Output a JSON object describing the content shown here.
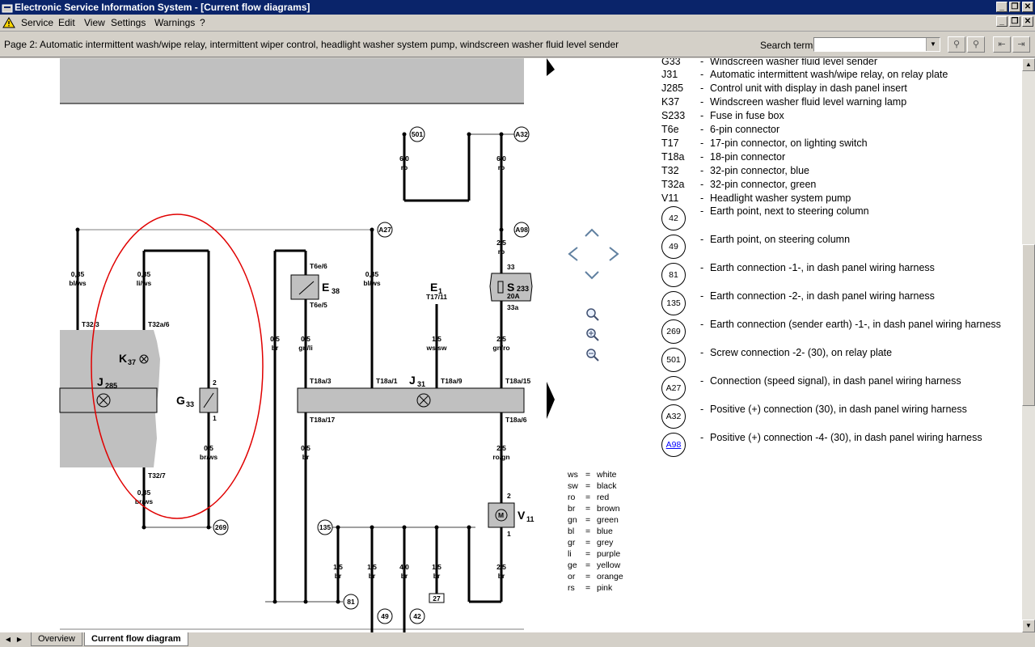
{
  "window": {
    "title": "Electronic Service Information System - [Current flow diagrams]"
  },
  "menu": [
    "Service",
    "Edit",
    "View",
    "Settings",
    "Warnings",
    "?"
  ],
  "toolbar": {
    "page_label": "Page 2: Automatic intermittent wash/wipe relay, intermittent wiper control, headlight washer system pump, windscreen washer fluid level sender",
    "search_label": "Search term:",
    "search_value": ""
  },
  "legend": {
    "components": [
      {
        "code": "G33",
        "desc": "Windscreen washer fluid level sender"
      },
      {
        "code": "J31",
        "desc": "Automatic intermittent wash/wipe relay, on relay plate"
      },
      {
        "code": "J285",
        "desc": "Control unit with display in dash panel insert"
      },
      {
        "code": "K37",
        "desc": "Windscreen washer fluid level warning lamp"
      },
      {
        "code": "S233",
        "desc": "Fuse in fuse box"
      },
      {
        "code": "T6e",
        "desc": "6-pin connector"
      },
      {
        "code": "T17",
        "desc": "17-pin connector, on lighting switch"
      },
      {
        "code": "T18a",
        "desc": "18-pin connector"
      },
      {
        "code": "T32",
        "desc": "32-pin connector, blue"
      },
      {
        "code": "T32a",
        "desc": "32-pin connector, green"
      },
      {
        "code": "V11",
        "desc": "Headlight washer system pump"
      }
    ],
    "circles": [
      {
        "code": "42",
        "desc": "Earth point, next to steering column"
      },
      {
        "code": "49",
        "desc": "Earth point, on steering column"
      },
      {
        "code": "81",
        "desc": "Earth connection -1-, in dash panel wiring harness"
      },
      {
        "code": "135",
        "desc": "Earth connection -2-, in dash panel wiring harness"
      },
      {
        "code": "269",
        "desc": "Earth connection (sender earth) -1-, in dash panel wiring harness"
      },
      {
        "code": "501",
        "desc": "Screw connection -2- (30), on relay plate"
      },
      {
        "code": "A27",
        "desc": "Connection (speed signal), in dash panel wiring harness"
      },
      {
        "code": "A32",
        "desc": "Positive (+) connection (30), in dash panel wiring harness"
      },
      {
        "code": "A98",
        "desc": "Positive (+) connection -4- (30), in dash panel wiring harness"
      }
    ]
  },
  "color_key": [
    {
      "abbr": "ws",
      "name": "white"
    },
    {
      "abbr": "sw",
      "name": "black"
    },
    {
      "abbr": "ro",
      "name": "red"
    },
    {
      "abbr": "br",
      "name": "brown"
    },
    {
      "abbr": "gn",
      "name": "green"
    },
    {
      "abbr": "bl",
      "name": "blue"
    },
    {
      "abbr": "gr",
      "name": "grey"
    },
    {
      "abbr": "li",
      "name": "purple"
    },
    {
      "abbr": "ge",
      "name": "yellow"
    },
    {
      "abbr": "or",
      "name": "orange"
    },
    {
      "abbr": "rs",
      "name": "pink"
    }
  ],
  "diagram": {
    "components": {
      "J285": "J",
      "J285_sub": "285",
      "K37": "K",
      "K37_sub": "37",
      "G33": "G",
      "G33_sub": "33",
      "E38": "E",
      "E38_sub": "38",
      "J31": "J",
      "J31_sub": "31",
      "E1": "E",
      "E1_sub": "1",
      "S233": "S",
      "S233_sub": "233",
      "S233_rating": "20A",
      "V11": "V",
      "V11_sub": "11",
      "E1_pin": "T17/11"
    },
    "wires": [
      {
        "size": "0,35",
        "color": "bl/ws"
      },
      {
        "size": "0,35",
        "color": "li/ws"
      },
      {
        "size": "0,5",
        "color": "br"
      },
      {
        "size": "0,5",
        "color": "gn/li"
      },
      {
        "size": "0,35",
        "color": "bl/ws"
      },
      {
        "size": "1,5",
        "color": "ws/sw"
      },
      {
        "size": "2,5",
        "color": "gn/ro"
      },
      {
        "size": "6,0",
        "color": "ro"
      },
      {
        "size": "6,0",
        "color": "ro"
      },
      {
        "size": "2,5",
        "color": "ro"
      },
      {
        "size": "0,5",
        "color": "br/ws"
      },
      {
        "size": "0,35",
        "color": "br/ws"
      },
      {
        "size": "0,5",
        "color": "br"
      },
      {
        "size": "2,5",
        "color": "ro/gn"
      },
      {
        "size": "1,5",
        "color": "br"
      },
      {
        "size": "1,5",
        "color": "br"
      },
      {
        "size": "4,0",
        "color": "br"
      },
      {
        "size": "1,5",
        "color": "br"
      },
      {
        "size": "2,5",
        "color": "br"
      }
    ],
    "pins": [
      "T32/3",
      "T32a/6",
      "T6e/6",
      "T6e/5",
      "T18a/3",
      "T18a/1",
      "T18a/9",
      "T18a/15",
      "T18a/17",
      "T18a/6",
      "T32/7",
      "2",
      "1",
      "33",
      "33a",
      "2",
      "1"
    ],
    "nodes": [
      "501",
      "A32",
      "A27",
      "A98",
      "269",
      "135",
      "81",
      "49",
      "42",
      "27"
    ]
  },
  "tabs": [
    "Overview",
    "Current flow diagram"
  ],
  "colors": {
    "titlebar": "#0a246a",
    "component_fill": "#c0c0c0",
    "highlight_ellipse": "#e00000"
  }
}
